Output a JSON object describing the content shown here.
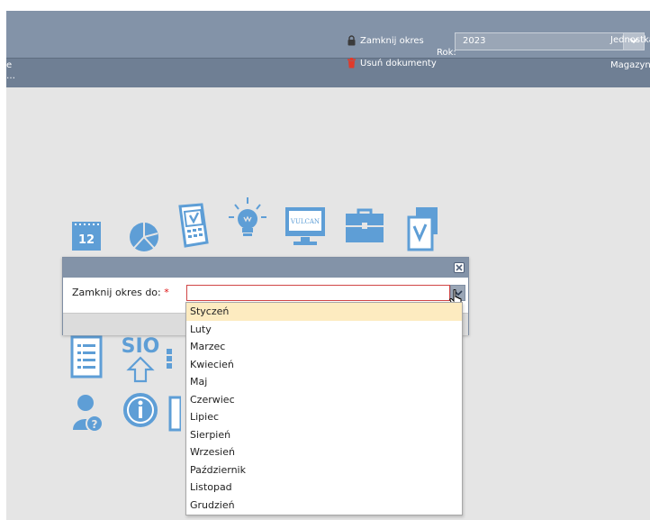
{
  "toolbar": {
    "close_period_label": "Zamknij okres",
    "delete_documents_label": "Usuń dokumenty",
    "year_label": "Rok:",
    "year_value": "2023",
    "unit_label": "Jednostka",
    "warehouse_label": "Magazyn:",
    "left_fragment_top": "e",
    "left_fragment_bottom": "…"
  },
  "tiles": {
    "calendar_number": "12",
    "vulcan_text": "VULCAN",
    "sio_text": "SIO"
  },
  "dialog": {
    "field_label": "Zamknij okres do:",
    "required_mark": "*",
    "field_value": ""
  },
  "dropdown": {
    "options": [
      "Styczeń",
      "Luty",
      "Marzec",
      "Kwiecień",
      "Maj",
      "Czerwiec",
      "Lipiec",
      "Sierpień",
      "Wrzesień",
      "Październik",
      "Listopad",
      "Grudzień"
    ],
    "highlighted": "Styczeń"
  },
  "colors": {
    "toolbar": "#8393a8",
    "content_bg": "#e5e5e5",
    "tile_icon": "#5e9ed6",
    "highlight": "#fdebc0",
    "error_border": "#d04545"
  },
  "icons": [
    "lock-icon",
    "trash-icon",
    "chevron-down-icon",
    "close-icon",
    "hand-cursor-icon",
    "calendar-icon",
    "pie-chart-icon",
    "calculator-icon",
    "lightbulb-icon",
    "vulcan-monitor-icon",
    "briefcase-icon",
    "document-check-icon",
    "list-document-icon",
    "sio-upload-icon",
    "user-help-icon",
    "info-icon"
  ]
}
